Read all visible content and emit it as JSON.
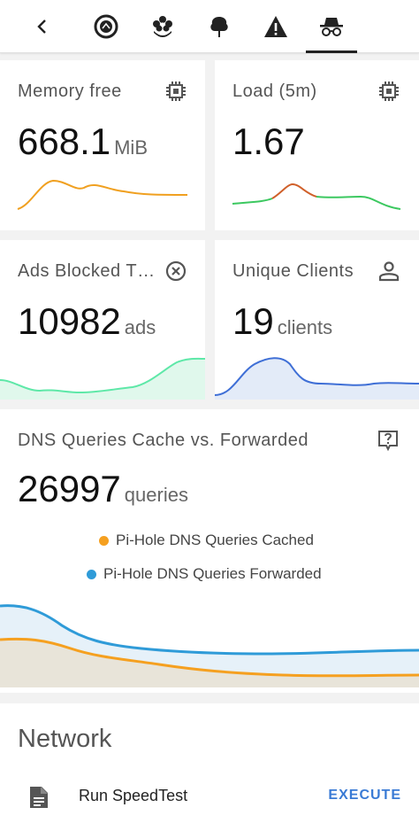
{
  "tabs": [
    {
      "name": "back-icon"
    },
    {
      "name": "home-assistant-icon"
    },
    {
      "name": "flower-icon"
    },
    {
      "name": "tree-icon"
    },
    {
      "name": "warning-icon"
    },
    {
      "name": "incognito-icon",
      "active": true
    }
  ],
  "cards": {
    "memory": {
      "title": "Memory free",
      "value": "668.1",
      "unit": "MiB",
      "icon": "chip-icon"
    },
    "load": {
      "title": "Load (5m)",
      "value": "1.67",
      "unit": "",
      "icon": "chip-icon"
    },
    "ads": {
      "title": "Ads Blocked T…",
      "value": "10982",
      "unit": "ads",
      "icon": "close-circle-icon"
    },
    "clients": {
      "title": "Unique Clients",
      "value": "19",
      "unit": "clients",
      "icon": "account-icon"
    }
  },
  "dns": {
    "title": "DNS Queries Cache vs. Forwarded",
    "value": "26997",
    "unit": "queries",
    "icon": "help-box-icon",
    "legend": [
      {
        "label": "Pi-Hole DNS Queries Cached",
        "color": "#f5a020"
      },
      {
        "label": "Pi-Hole DNS Queries Forwarded",
        "color": "#2f9bd8"
      }
    ]
  },
  "network": {
    "title": "Network",
    "item_label": "Run SpeedTest",
    "action_label": "EXECUTE",
    "icon": "file-document-icon"
  },
  "colors": {
    "accent": "#3a7bd5",
    "memory_line": "#f0a020",
    "ads_line": "#5ee8a8",
    "clients_line": "#3f6fd6"
  }
}
